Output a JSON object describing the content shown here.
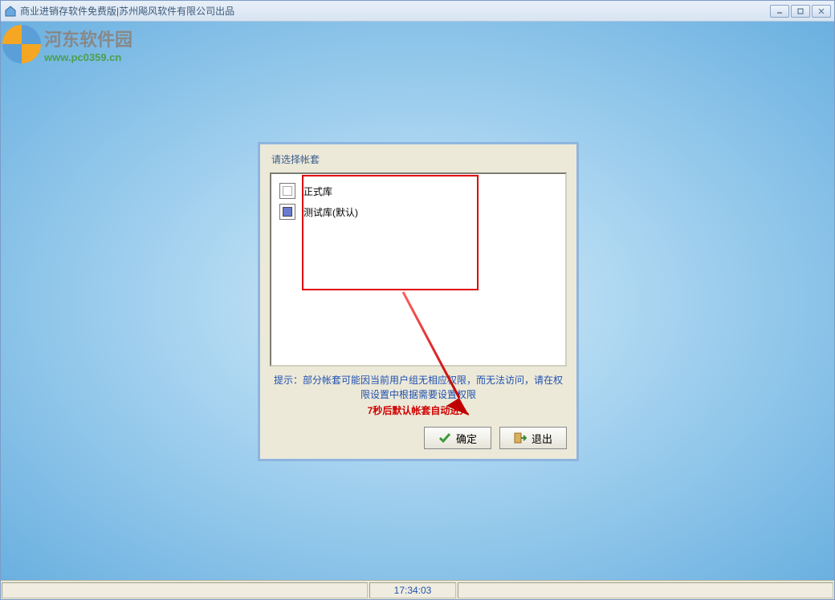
{
  "window": {
    "title": "商业进销存软件免费版|苏州飚风软件有限公司出品"
  },
  "watermark": {
    "title": "河东软件园",
    "url": "www.pc0359.cn"
  },
  "dialog": {
    "title": "请选择帐套",
    "items": [
      {
        "label": "正式库",
        "icon": "formal"
      },
      {
        "label": "测试库(默认)",
        "icon": "test"
      }
    ],
    "hint": "提示：部分帐套可能因当前用户组无相应权限，而无法访问，请在权限设置中根据需要设置权限",
    "countdown": "7秒后默认帐套自动进入",
    "buttons": {
      "ok": "确定",
      "exit": "退出"
    }
  },
  "statusbar": {
    "time": "17:34:03"
  }
}
